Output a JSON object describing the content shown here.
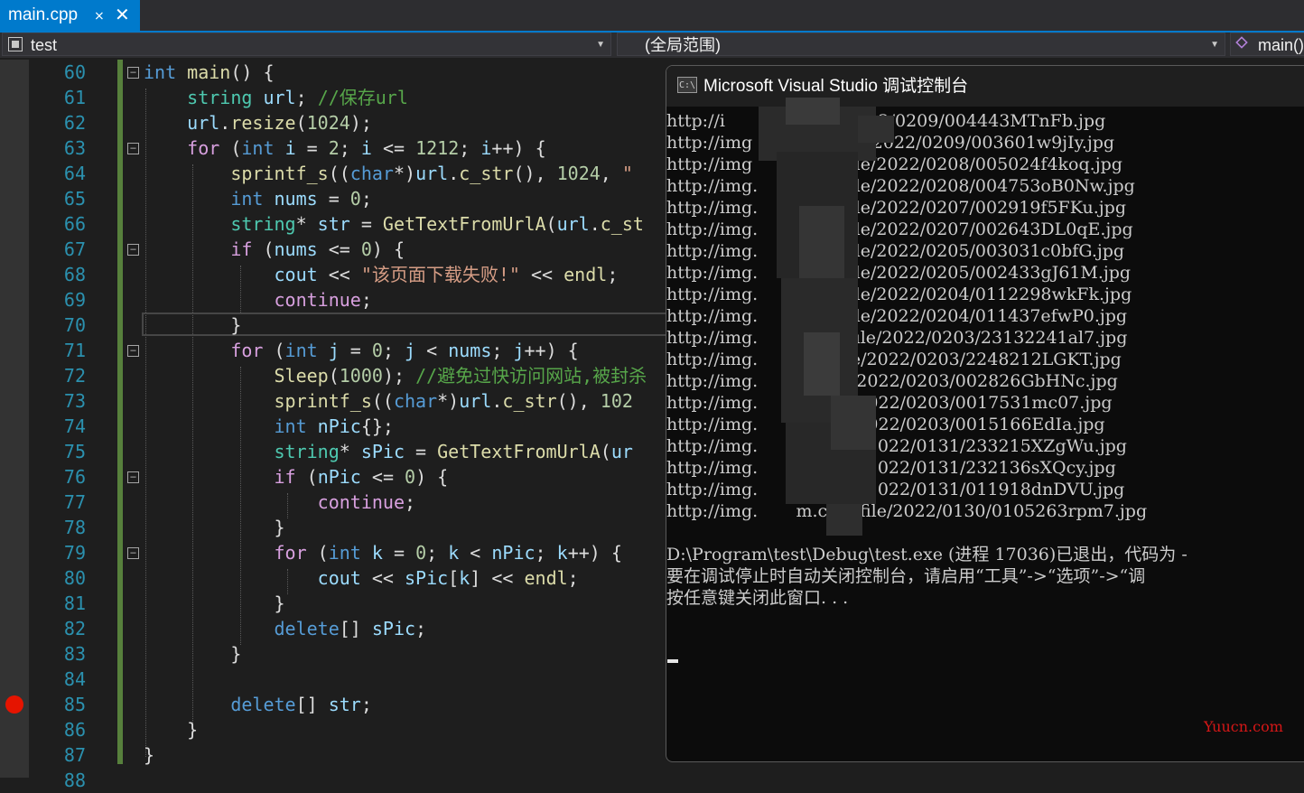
{
  "tab": {
    "title": "main.cpp",
    "pin": "⨯"
  },
  "nav": {
    "project": "test",
    "scope": "(全局范围)",
    "member": "main()"
  },
  "editor": {
    "lines": [
      {
        "n": "60",
        "fold": true
      },
      {
        "n": "61"
      },
      {
        "n": "62"
      },
      {
        "n": "63",
        "fold": true
      },
      {
        "n": "64"
      },
      {
        "n": "65"
      },
      {
        "n": "66"
      },
      {
        "n": "67",
        "fold": true
      },
      {
        "n": "68"
      },
      {
        "n": "69"
      },
      {
        "n": "70"
      },
      {
        "n": "71",
        "fold": true
      },
      {
        "n": "72"
      },
      {
        "n": "73"
      },
      {
        "n": "74"
      },
      {
        "n": "75"
      },
      {
        "n": "76",
        "fold": true
      },
      {
        "n": "77"
      },
      {
        "n": "78"
      },
      {
        "n": "79",
        "fold": true
      },
      {
        "n": "80"
      },
      {
        "n": "81"
      },
      {
        "n": "82"
      },
      {
        "n": "83"
      },
      {
        "n": "84"
      },
      {
        "n": "85",
        "breakpoint": true
      },
      {
        "n": "86"
      },
      {
        "n": "87"
      },
      {
        "n": "88"
      }
    ],
    "code": {
      "l61_comment": "//保存url",
      "l64_str": "\"",
      "l68_str": "\"该页面下载失败!\"",
      "l72_comment": "//避免过快访问网站,被封杀"
    }
  },
  "console": {
    "title": "Microsoft Visual Studio 调试控制台",
    "icon": "C:\\",
    "lines": [
      "http://i            m/file/2022/0209/004443MTnFb.jpg",
      "http://img         .om/file/2022/0209/003601w9jIy.jpg",
      "http://img         com/file/2022/0208/005024f4koq.jpg",
      "http://img.        com/file/2022/0208/004753oB0Nw.jpg",
      "http://img.        com/file/2022/0207/002919f5FKu.jpg",
      "http://img.        com/file/2022/0207/002643DL0qE.jpg",
      "http://img.        com/file/2022/0205/003031c0bfG.jpg",
      "http://img.        com/file/2022/0205/002433gJ61M.jpg",
      "http://img.        com/file/2022/0204/0112298wkFk.jpg",
      "http://img.        com/file/2022/0204/011437efwP0.jpg",
      "http://img.        .com/file/2022/0203/23132241al7.jpg",
      "http://img.       .c/n/file/2022/0203/2248212LGKT.jpg",
      "http://img.        m/file/2022/0203/002826GbHNc.jpg",
      "http://img.        m/file/2022/0203/0017531mc07.jpg",
      "http://img.        m/file/2022/0203/0015166EdIa.jpg",
      "http://img.        om/file/2022/0131/233215XZgWu.jpg",
      "http://img.        om/file/2022/0131/232136sXQcy.jpg",
      "http://img.        om/file/2022/0131/011918dnDVU.jpg",
      "http://img.       m.com/file/2022/0130/0105263rpm7.jpg",
      "",
      "D:\\Program\\test\\Debug\\test.exe (进程 17036)已退出，代码为 -",
      "要在调试停止时自动关闭控制台，请启用“工具”->“选项”->“调",
      "按任意键关闭此窗口. . ."
    ]
  },
  "watermark": "Yuucn.com"
}
